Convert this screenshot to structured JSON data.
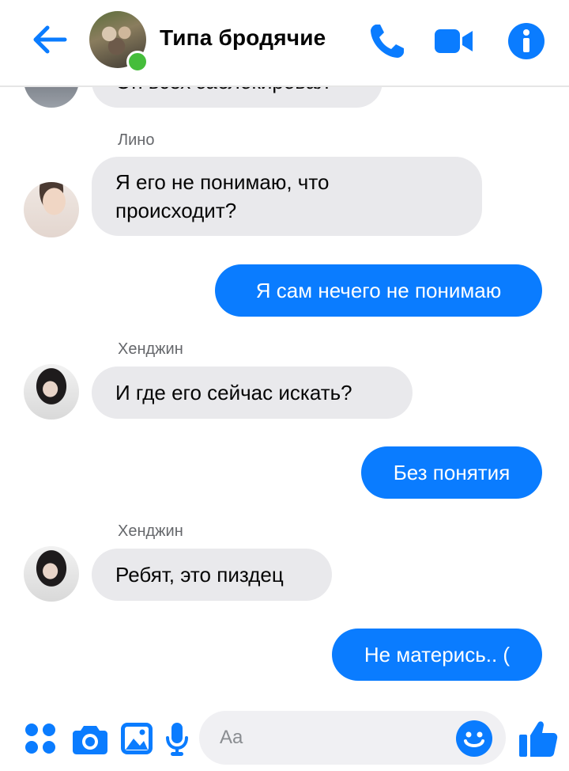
{
  "header": {
    "title": "Типа бродячие",
    "accent_color": "#0a7cff",
    "online_color": "#45bd3b",
    "icons": [
      "back-arrow-icon",
      "phone-icon",
      "video-camera-icon",
      "info-icon"
    ]
  },
  "messages": [
    {
      "direction": "in",
      "sender": "",
      "text": "Он всех заблокировал"
    },
    {
      "direction": "in",
      "sender": "Лино",
      "text": "Я его не понимаю, что\nпроисходит?"
    },
    {
      "direction": "out",
      "text": "Я сам нечего не понимаю"
    },
    {
      "direction": "in",
      "sender": "Хенджин",
      "text": "И где его сейчас искать?"
    },
    {
      "direction": "out",
      "text": "Без понятия"
    },
    {
      "direction": "in",
      "sender": "Хенджин",
      "text": "Ребят, это пиздец"
    },
    {
      "direction": "out",
      "text": "Не матерись.. ("
    }
  ],
  "composer": {
    "placeholder": "Aa",
    "icons": [
      "more-icon",
      "camera-icon",
      "gallery-icon",
      "microphone-icon",
      "emoji-icon",
      "thumbs-up-icon"
    ]
  }
}
